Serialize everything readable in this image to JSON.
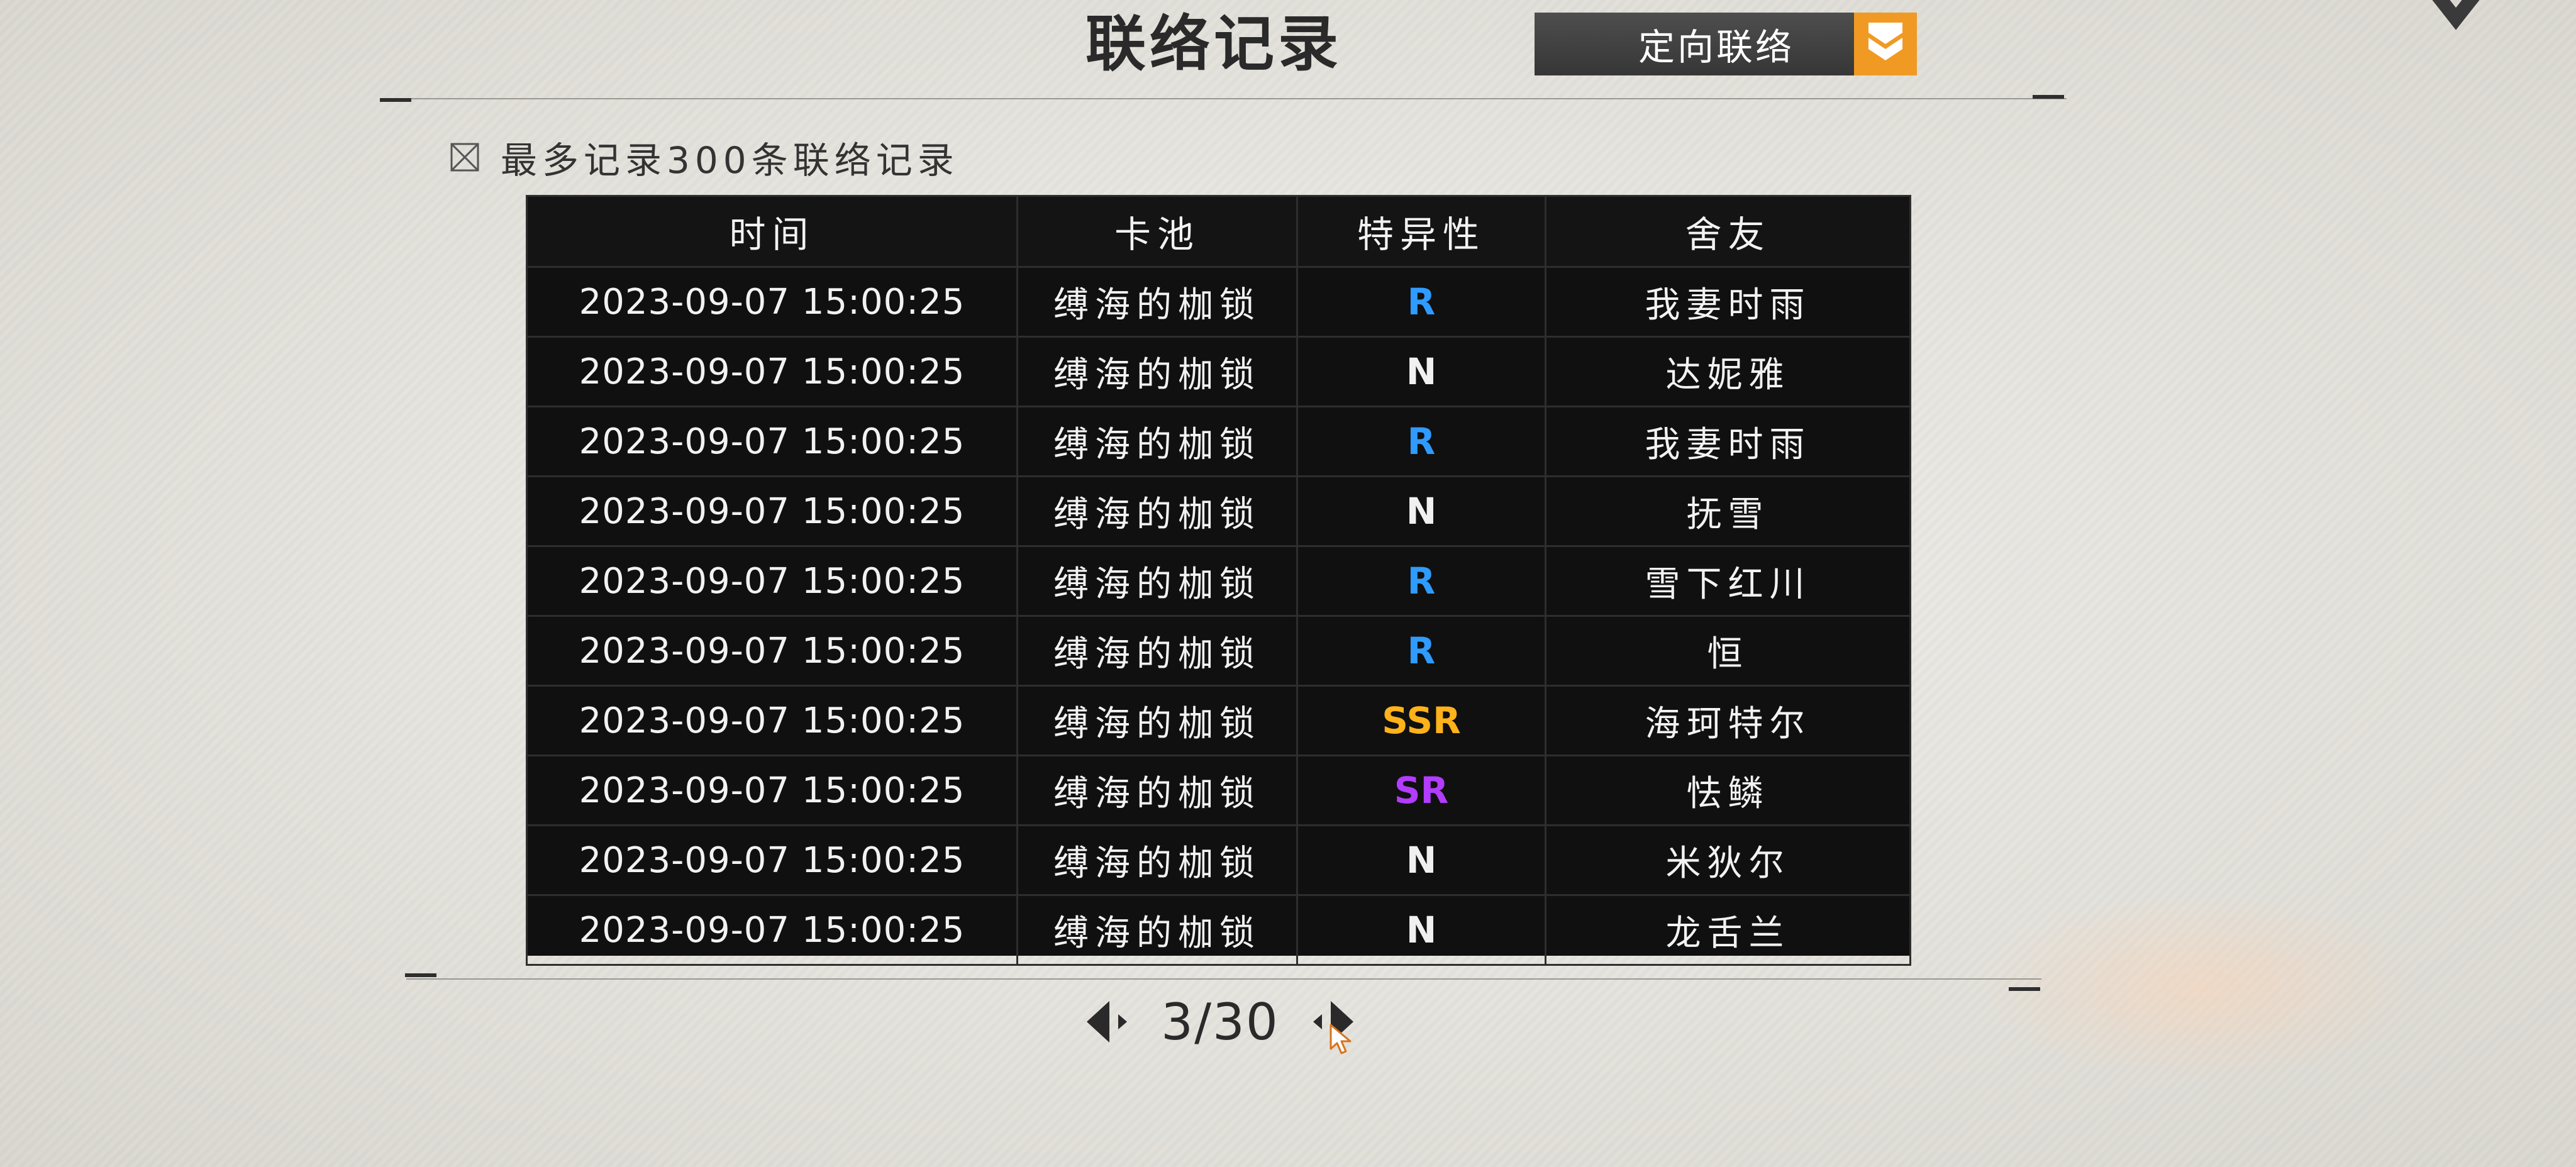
{
  "header": {
    "title": "联络记录",
    "mode_select": {
      "label": "定向联络"
    }
  },
  "notice": {
    "text": "最多记录300条联络记录",
    "checked": false
  },
  "table": {
    "columns": [
      "时间",
      "卡池",
      "特异性",
      "舍友"
    ],
    "rows": [
      {
        "time": "2023-09-07 15:00:25",
        "pool": "缚海的枷锁",
        "rarity": "R",
        "friend": "我妻时雨"
      },
      {
        "time": "2023-09-07 15:00:25",
        "pool": "缚海的枷锁",
        "rarity": "N",
        "friend": "达妮雅"
      },
      {
        "time": "2023-09-07 15:00:25",
        "pool": "缚海的枷锁",
        "rarity": "R",
        "friend": "我妻时雨"
      },
      {
        "time": "2023-09-07 15:00:25",
        "pool": "缚海的枷锁",
        "rarity": "N",
        "friend": "抚雪"
      },
      {
        "time": "2023-09-07 15:00:25",
        "pool": "缚海的枷锁",
        "rarity": "R",
        "friend": "雪下红川"
      },
      {
        "time": "2023-09-07 15:00:25",
        "pool": "缚海的枷锁",
        "rarity": "R",
        "friend": "恒"
      },
      {
        "time": "2023-09-07 15:00:25",
        "pool": "缚海的枷锁",
        "rarity": "SSR",
        "friend": "海珂特尔"
      },
      {
        "time": "2023-09-07 15:00:25",
        "pool": "缚海的枷锁",
        "rarity": "SR",
        "friend": "怯鳞"
      },
      {
        "time": "2023-09-07 15:00:25",
        "pool": "缚海的枷锁",
        "rarity": "N",
        "friend": "米狄尔"
      },
      {
        "time": "2023-09-07 15:00:25",
        "pool": "缚海的枷锁",
        "rarity": "N",
        "friend": "龙舌兰"
      }
    ]
  },
  "rarity_colors": {
    "N": "#f0f0f0",
    "R": "#2f9bff",
    "SR": "#b23cff",
    "SSR": "#ffb21a"
  },
  "accent_color": "#f09a24",
  "pager": {
    "current": 3,
    "total": 30,
    "text": "3/30"
  },
  "icons": {
    "mode_arrow": "chevron-down-icon",
    "checkbox": "checkbox-icon",
    "prev": "prev-page-icon",
    "next": "next-page-icon",
    "logo": "corner-logo-icon",
    "cursor": "mouse-cursor-icon"
  }
}
